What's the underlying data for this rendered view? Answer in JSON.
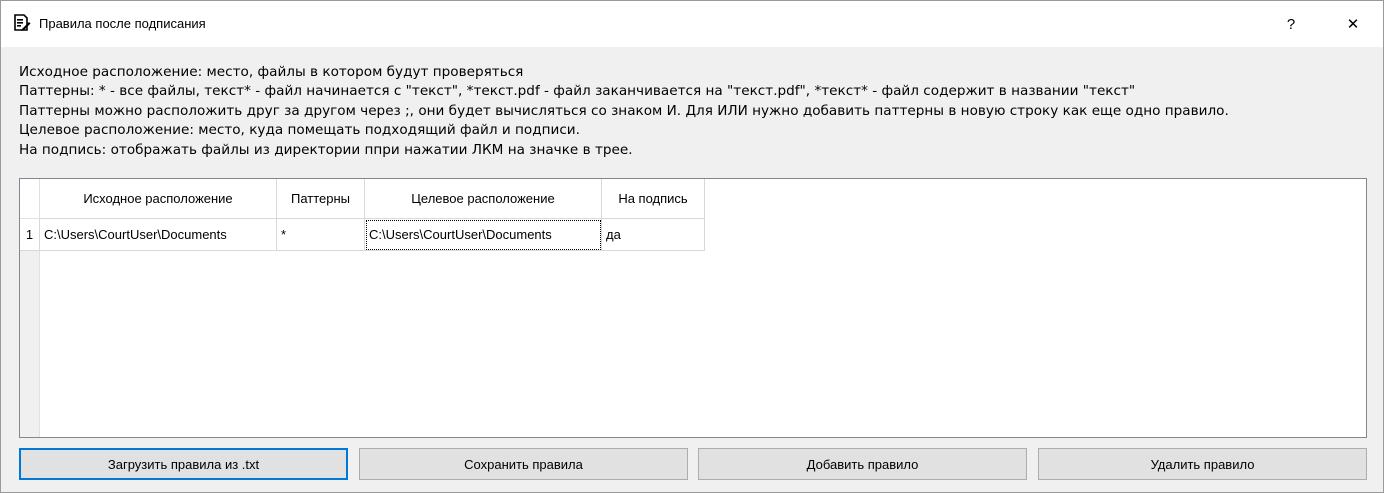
{
  "window": {
    "title": "Правила после подписания",
    "help_symbol": "?",
    "close_symbol": "✕"
  },
  "description": [
    "Исходное расположение: место, файлы в котором будут проверяться",
    "Паттерны: * - все файлы, текст* - файл начинается с \"текст\", *текст.pdf - файл заканчивается на \"текст.pdf\", *текст* - файл содержит в названии \"текст\"",
    "Паттерны можно расположить друг за другом через ;, они будет вычисляться со знаком И. Для ИЛИ нужно добавить паттерны в новую строку как еще одно правило.",
    "Целевое расположение: место, куда помещать подходящий файл и подписи.",
    "На подпись: отображать файлы из директории ппри нажатии ЛКМ на значке в трее."
  ],
  "table": {
    "columns": [
      "Исходное расположение",
      "Паттерны",
      "Целевое расположение",
      "На подпись"
    ],
    "rows": [
      {
        "num": "1",
        "cells": [
          "C:\\Users\\CourtUser\\Documents",
          "*",
          "C:\\Users\\CourtUser\\Documents",
          "да"
        ]
      }
    ]
  },
  "buttons": {
    "load": "Загрузить правила из .txt",
    "save": "Сохранить правила",
    "add": "Добавить правило",
    "delete": "Удалить правило"
  },
  "icons": {
    "title_icon": "document-signature-icon"
  }
}
